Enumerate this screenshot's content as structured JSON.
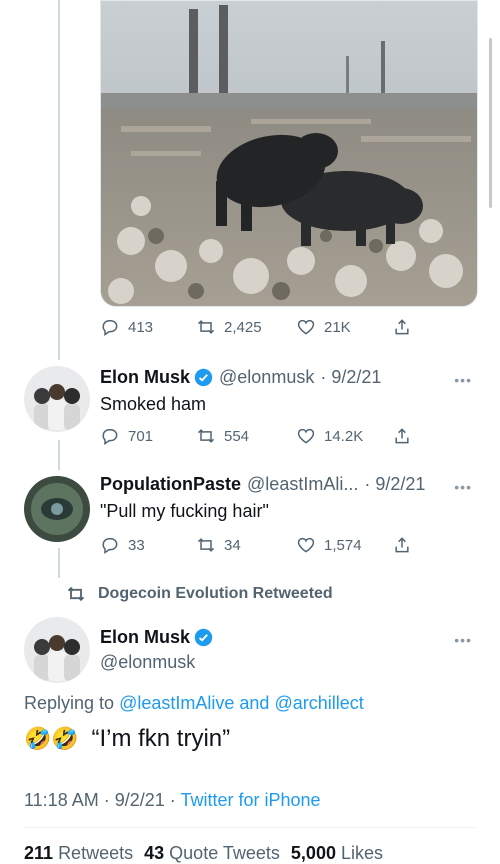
{
  "tweet0": {
    "replies": "413",
    "retweets": "2,425",
    "likes": "21K"
  },
  "reply1": {
    "name": "Elon Musk",
    "handle": "@elonmusk",
    "date": "· 9/2/21",
    "text": "Smoked ham",
    "replies": "701",
    "retweets": "554",
    "likes": "14.2K"
  },
  "reply2": {
    "name": "PopulationPaste",
    "handle": "@leastImAli...",
    "date": "· 9/2/21",
    "text": "\"Pull my fucking hair\"",
    "replies": "33",
    "retweets": "34",
    "likes": "1,574"
  },
  "retweet_banner": "Dogecoin Evolution Retweeted",
  "main": {
    "name": "Elon Musk",
    "handle": "@elonmusk",
    "replying_prefix": "Replying to",
    "replying_user1": "@leastImAlive",
    "replying_and": "and",
    "replying_user2": "@archillect",
    "emoji": "🤣🤣",
    "text": "“I’m fkn tryin”",
    "time": "11:18 AM · 9/2/21 ·",
    "source": "Twitter for iPhone",
    "retweets_count": "211",
    "retweets_label": "Retweets",
    "quotes_count": "43",
    "quotes_label": "Quote Tweets",
    "likes_count": "5,000",
    "likes_label": "Likes"
  },
  "colors": {
    "accent": "#1d9bf0",
    "muted": "#536471",
    "verified": "#1d9bf0"
  }
}
